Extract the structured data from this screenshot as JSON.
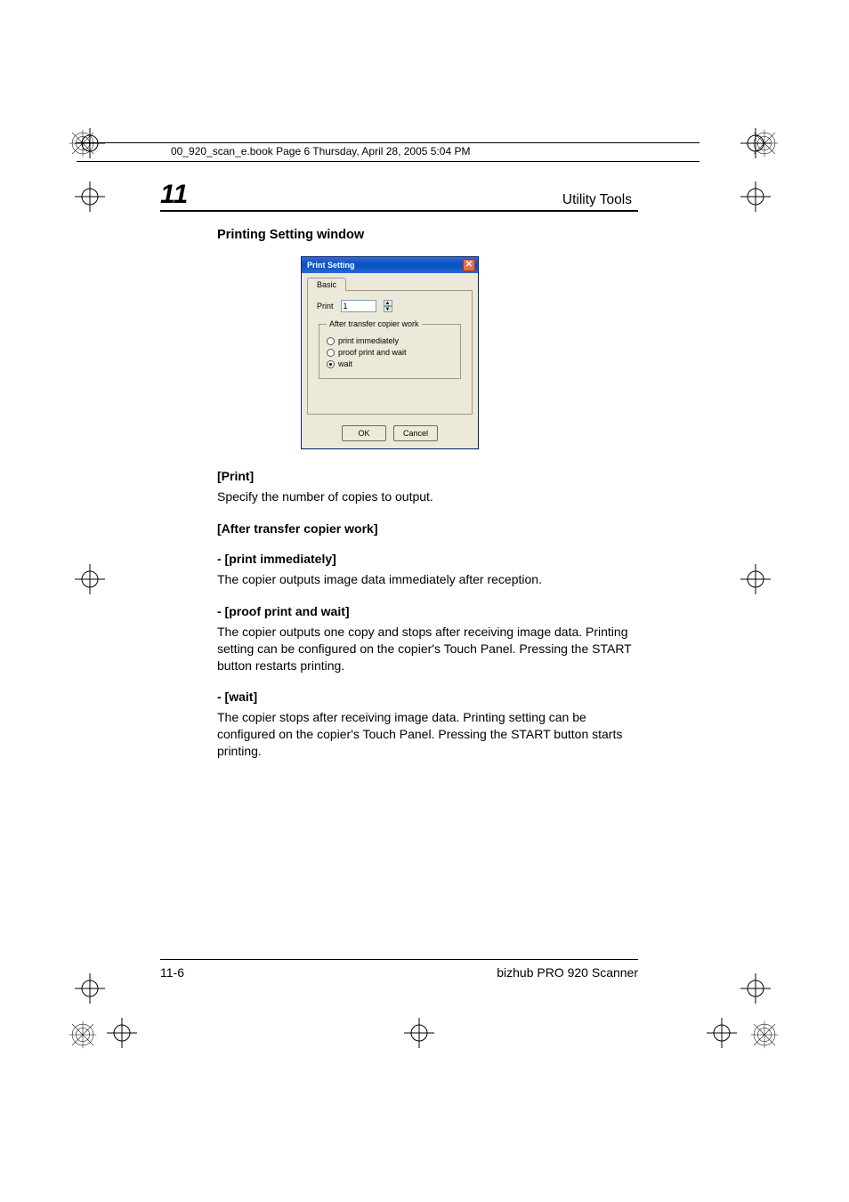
{
  "book_header": "00_920_scan_e.book  Page 6  Thursday, April 28, 2005  5:04 PM",
  "chapter": {
    "number": "11",
    "title": "Utility Tools"
  },
  "subsection_title": "Printing Setting window",
  "dialog": {
    "title": "Print Setting",
    "tab": "Basic",
    "print_label": "Print",
    "print_value": "1",
    "fieldset_legend": "After transfer copier work",
    "radio1": "print immediately",
    "radio2": "proof print and wait",
    "radio3": "wait",
    "ok": "OK",
    "cancel": "Cancel"
  },
  "sections": {
    "print_h": "[Print]",
    "print_body": "Specify the number of copies to output.",
    "after_h": "[After transfer copier work]",
    "opt1_h": "- [print immediately]",
    "opt1_body": "The copier outputs image data immediately after reception.",
    "opt2_h": "- [proof print and wait]",
    "opt2_body": "The copier outputs one copy and stops after receiving image data. Printing setting can be configured on the copier's Touch Panel. Pressing the START button restarts printing.",
    "opt3_h": "- [wait]",
    "opt3_body": "The copier stops after receiving image data. Printing setting can be configured on the copier's Touch Panel. Pressing the START button starts printing."
  },
  "footer": {
    "page": "11-6",
    "product": "bizhub PRO 920 Scanner"
  }
}
